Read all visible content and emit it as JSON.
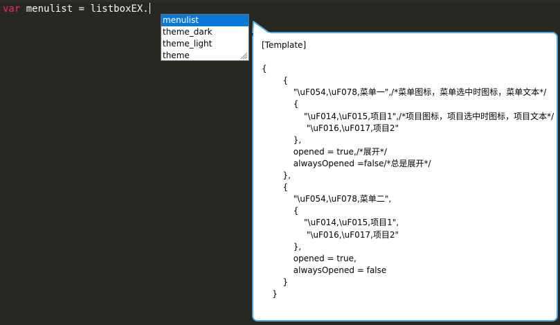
{
  "editor": {
    "code_keyword": "var",
    "code_rest": " menulist = listboxEX."
  },
  "autocomplete": {
    "items": [
      "menulist",
      "theme_dark",
      "theme_light",
      "theme"
    ],
    "selected": "menulist"
  },
  "tooltip": {
    "title": "[Template]",
    "body": "{\n        {\n            \"\\uF054,\\uF078,菜单一\",/*菜单图标，菜单选中时图标，菜单文本*/\n            {\n                \"\\uF014,\\uF015,项目1\",/*项目图标，项目选中时图标，项目文本*/\n                 \"\\uF016,\\uF017,项目2\"\n            },\n            opened = true,/*展开*/\n            alwaysOpened =false/*总是展开*/\n        },\n        {\n            \"\\uF054,\\uF078,菜单二\",\n            {\n                \"\\uF014,\\uF015,项目1\",\n                 \"\\uF016,\\uF017,项目2\"\n            },\n            opened = true,\n            alwaysOpened = false\n        }\n    }"
  },
  "colors": {
    "editor_bg": "#272822",
    "keyword": "#f92672",
    "code_text": "#f8f8f2",
    "selection": "#0a78d7",
    "tooltip_border": "#4da8e6"
  },
  "icons": {
    "grip": "resize-grip-icon",
    "caret": "text-cursor"
  }
}
